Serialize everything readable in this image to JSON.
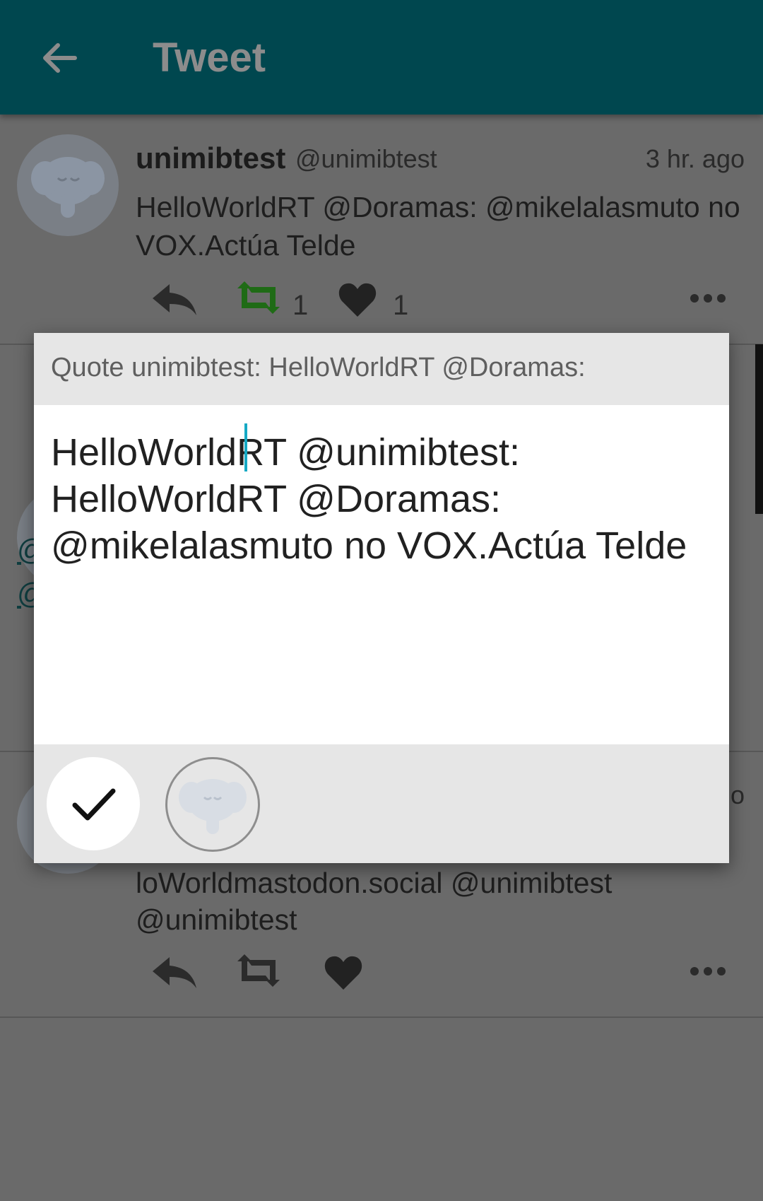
{
  "appbar": {
    "title": "Tweet"
  },
  "tweet1": {
    "username": "unimibtest",
    "handle": "@unimibtest",
    "time": "3 hr. ago",
    "content": "HelloWorldRT @Doramas: @mikelalasmuto no VOX.Actúa Telde",
    "retweet_count": "1",
    "like_count": "1"
  },
  "tweet3": {
    "time_partial": "o",
    "content_line1": "loWorldmastodon.social @unimibtest",
    "content_line2": "@unimibtest"
  },
  "partial_mentions": [
    "@",
    "@"
  ],
  "dialog": {
    "title": "Quote unimibtest: HelloWorldRT @Doramas:",
    "text_before_cursor": "HelloWorld",
    "text_after_cursor": "RT @unimibtest: HelloWorldRT @Doramas: @mikelalasmuto no VOX.Actúa Telde"
  },
  "colors": {
    "appbar": "#00474f",
    "retweet_active": "#1f6b16",
    "cursor": "#16a9c4"
  },
  "icons": {
    "back": "arrow-left-icon",
    "reply": "reply-icon",
    "retweet": "retweet-icon",
    "like": "heart-icon",
    "more": "more-horizontal-icon",
    "send": "check-icon",
    "avatar": "mastodon-elephant-icon"
  }
}
